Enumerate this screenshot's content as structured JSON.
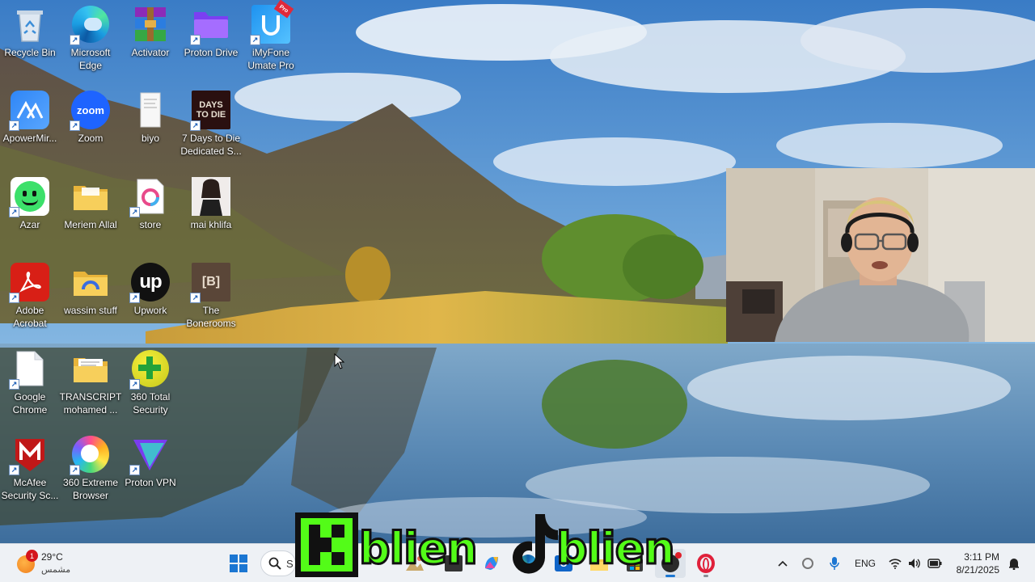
{
  "desktop": {
    "icons": [
      {
        "label": "Recycle Bin",
        "icon": "recycle-bin-icon"
      },
      {
        "label": "Microsoft Edge",
        "icon": "edge-icon"
      },
      {
        "label": "Activator",
        "icon": "archive-icon"
      },
      {
        "label": "Proton Drive",
        "icon": "folder-icon"
      },
      {
        "label": "iMyFone Umate Pro",
        "icon": "imyfone-icon",
        "badge": "Pro"
      },
      {
        "label": "ApowerMir...",
        "icon": "apowermirror-icon"
      },
      {
        "label": "Zoom",
        "icon": "zoom-icon",
        "glyph": "zoom"
      },
      {
        "label": "biyo",
        "icon": "document-icon"
      },
      {
        "label": "7 Days to Die Dedicated S...",
        "icon": "game-icon",
        "glyph": "DAYS TO DIE"
      },
      {
        "label": "Azar",
        "icon": "azar-icon"
      },
      {
        "label": "Meriem Allal",
        "icon": "folder-icon"
      },
      {
        "label": "store",
        "icon": "store-icon"
      },
      {
        "label": "mai khlifa",
        "icon": "portrait-icon"
      },
      {
        "label": "Adobe Acrobat",
        "icon": "acrobat-icon"
      },
      {
        "label": "wassim stuff",
        "icon": "folder-icon"
      },
      {
        "label": "Upwork",
        "icon": "upwork-icon",
        "glyph": "up"
      },
      {
        "label": "The Bonerooms",
        "icon": "bonerooms-icon",
        "glyph": "[B]"
      },
      {
        "label": "Google Chrome",
        "icon": "document-icon"
      },
      {
        "label": "TRANSCRIPT mohamed ...",
        "icon": "folder-icon"
      },
      {
        "label": "360 Total Security",
        "icon": "security-plus-icon"
      },
      {
        "label": "McAfee Security Sc...",
        "icon": "mcafee-icon"
      },
      {
        "label": "360 Extreme Browser",
        "icon": "browser-ring-icon"
      },
      {
        "label": "Proton VPN",
        "icon": "vpn-icon"
      }
    ]
  },
  "taskbar": {
    "weather": {
      "temp": "29°C",
      "condition": "مشمس",
      "badge": "1"
    },
    "search": {
      "text": "S"
    },
    "tray": {
      "language": "ENG",
      "time": "3:11 PM",
      "date": "8/21/2025"
    }
  },
  "watermark": {
    "text_left": "blien",
    "text_right": "blien"
  },
  "colors": {
    "taskbar_bg": "#eef1f5",
    "kick_green": "#53fc18",
    "folder_yellow": "#f4c94a"
  }
}
